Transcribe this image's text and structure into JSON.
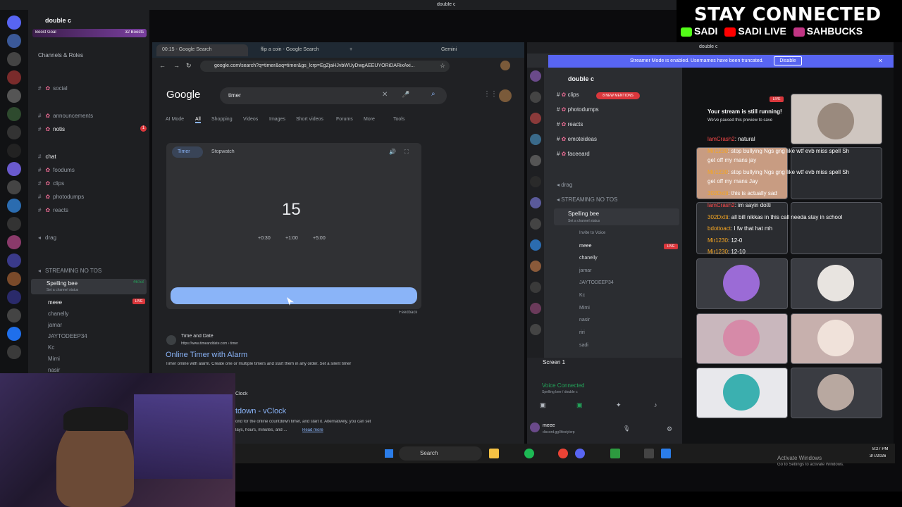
{
  "banner": {
    "title": "STAY CONNECTED",
    "sadi": "SADI",
    "sadi_live": "SADI LIVE",
    "sahbucks": "SAHBUCKS"
  },
  "top_window_title": "double c",
  "left_discord": {
    "server_name": "double c",
    "boost_goal": "Boost Goal",
    "boosts": "32 Boosts",
    "channels_roles": "Channels & Roles",
    "channels": [
      {
        "name": "social"
      },
      {
        "name": "announcements"
      },
      {
        "name": "notis",
        "badge": "1"
      },
      {
        "name": "chat"
      },
      {
        "name": "foodums"
      },
      {
        "name": "clips"
      },
      {
        "name": "photodumps"
      },
      {
        "name": "reacts"
      }
    ],
    "drag": "drag",
    "streaming": "STREAMING NO TOS",
    "voice_channel": "Spelling bee",
    "voice_time": "46:53",
    "voice_status": "Set a channel status",
    "live": "LIVE",
    "users": [
      "meee",
      "chanelly",
      "jamar",
      "JAYTODEEP34",
      "Kc",
      "Mimi",
      "nasir"
    ]
  },
  "chrome": {
    "tab1": "00:15 - Google Search",
    "tab2": "flip a coin - Google Search",
    "gemini": "Gemini",
    "url": "google.com/search?q=timer&oq=timer&gs_lcrp=EgZjaHJvbWUyDwgAEEUYORiDARixAxi...",
    "logo": "Google",
    "query": "timer",
    "nav": [
      "AI Mode",
      "All",
      "Shopping",
      "Videos",
      "Images",
      "Short videos",
      "Forums",
      "More",
      "Tools"
    ],
    "timer_tab": "Timer",
    "stopwatch_tab": "Stopwatch",
    "timer_value": "15",
    "add30": "+0:30",
    "add1": "+1:00",
    "add5": "+5:00",
    "feedback": "Feedback",
    "result_site": "Time and Date",
    "result_url": "https://www.timeanddate.com › timer",
    "result_title": "Online Timer with Alarm",
    "result_snippet": "Timer online with alarm. Create one or multiple timers and start them in any order. Set a silent timer",
    "vclock_label": "Clock",
    "vclock_title": "tdown - vClock",
    "vclock_snippet": "ond for the online countdown timer, and start it. Alternatively, you can set",
    "vclock_snippet2": "lays, hours, minutes, and ...",
    "read_more": "Read more"
  },
  "right_discord": {
    "title": "double c",
    "streamer_mode": "Streamer Mode is enabled. Usernames have been truncated.",
    "disable": "Disable",
    "server_name": "double c",
    "channels": [
      {
        "name": "clips",
        "badge": "8 NEW MENTIONS"
      },
      {
        "name": "photodumps"
      },
      {
        "name": "reacts"
      },
      {
        "name": "emoteideas"
      },
      {
        "name": "faceeard"
      }
    ],
    "drag": "drag",
    "streaming": "STREAMING NO TOS",
    "voice_channel": "Spelling bee",
    "voice_status": "Set a channel status",
    "invite": "Invite to Voice",
    "users": [
      "meee",
      "chanelly",
      "jamar",
      "JAYTODEEP34",
      "Kc",
      "Mimi",
      "nasir",
      "riri",
      "sadi"
    ],
    "screen": "Screen 1",
    "voice_connected": "Voice Connected",
    "voice_sub": "Spelling bee / double c",
    "self_name": "meee",
    "self_sub": "discord.gg/lifestylerp",
    "live": "LIVE",
    "stream_running": "Your stream is still running!",
    "stream_paused": "We've paused this preview to save",
    "chat": [
      {
        "user": "lamCrash2",
        "msg": ": natural"
      },
      {
        "user": "Mir1230",
        "msg": ": stop bullying Ngs gng like wtf evb miss spell Sh"
      },
      {
        "user": "",
        "msg": "get off my mans jay"
      },
      {
        "user": "Mir1230",
        "msg": ": stop bullying Ngs gng like wtf evb miss spell Sh"
      },
      {
        "user": "",
        "msg": "get off my mans Jay"
      },
      {
        "user": "302Dxtti",
        "msg": ": this is actually sad"
      },
      {
        "user": "lamCrash2",
        "msg": ": im sayin dotti"
      },
      {
        "user": "302Dxtti",
        "msg": ": all bill nikkas in this call needa stay in school"
      },
      {
        "user": "bdottoact",
        "msg": ": I fw that hat mh"
      },
      {
        "user": "Mir1230",
        "msg": ": 12-0"
      },
      {
        "user": "Mir1230",
        "msg": ": 12-10"
      }
    ]
  },
  "taskbar": {
    "search": "Search",
    "time": "8:27 PM",
    "date": "3/7/2026",
    "activate": "Activate Windows",
    "activate_sub": "Go to Settings to activate Windows."
  },
  "colors": {
    "accent": "#5865f2",
    "live": "#da373c",
    "google_blue": "#8ab4f8",
    "link": "#8ab4f8"
  }
}
